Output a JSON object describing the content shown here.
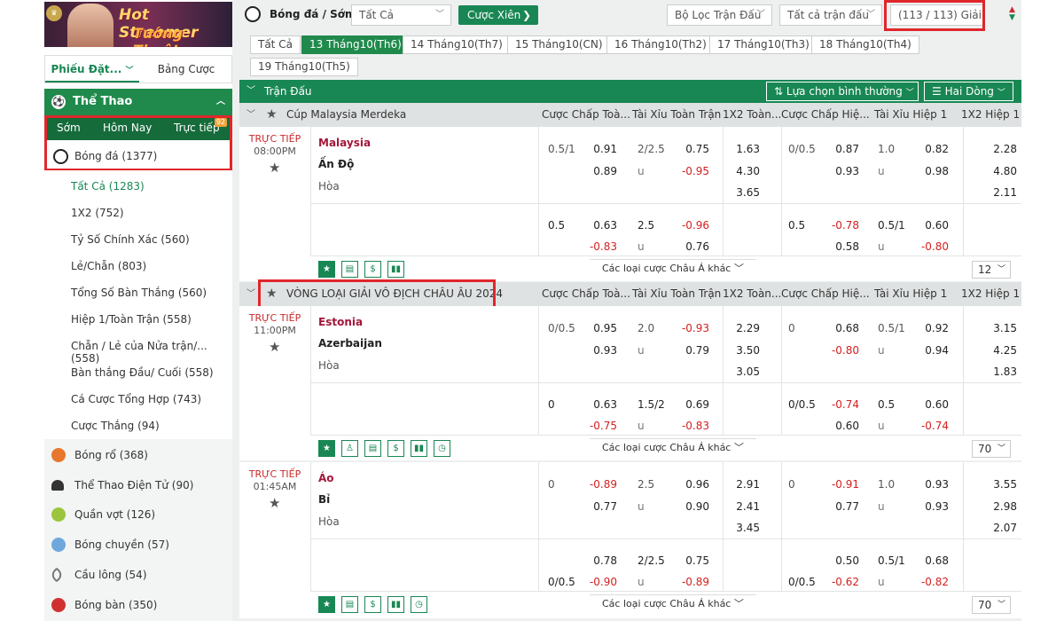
{
  "banner": {
    "line1": "Hot Streamer",
    "line2": "Tướng Thuật"
  },
  "sidebar": {
    "tabs": [
      {
        "label": "Phiếu Đặt..."
      },
      {
        "label": "Bảng Cược"
      }
    ],
    "sport_header": "Thể Thao",
    "subtabs": [
      {
        "label": "Sớm"
      },
      {
        "label": "Hôm Nay"
      },
      {
        "label": "Trực tiếp"
      }
    ],
    "live_badge": "92",
    "current_sport": "Bóng đá (1377)",
    "submenu": [
      {
        "label": "Tất Cả",
        "count": "(1283)"
      },
      {
        "label": "1X2",
        "count": "(752)"
      },
      {
        "label": "Tỷ Số Chính Xác",
        "count": "(560)"
      },
      {
        "label": "Lẻ/Chẵn",
        "count": "(803)"
      },
      {
        "label": "Tổng Số Bàn Thắng",
        "count": "(560)"
      },
      {
        "label": "Hiệp 1/Toàn Trận",
        "count": "(558)"
      },
      {
        "label": "Chẵn / Lẻ của Nửa trận/...",
        "count": "(558)"
      },
      {
        "label": "Bàn thắng Đầu/ Cuối",
        "count": "(558)"
      },
      {
        "label": "Cá Cược Tổng Hợp",
        "count": "(743)"
      },
      {
        "label": "Cược Thắng",
        "count": "(94)"
      }
    ],
    "sports": [
      {
        "label": "Bóng rổ (368)",
        "icon": "basketball-icon",
        "color": "#e8772e"
      },
      {
        "label": "Thể Thao Điện Tử (90)",
        "icon": "headset-icon",
        "color": "#333333"
      },
      {
        "label": "Quần vợt (126)",
        "icon": "tennis-icon",
        "color": "#9bc53d"
      },
      {
        "label": "Bóng chuyền (57)",
        "icon": "volleyball-icon",
        "color": "#6fa8dc"
      },
      {
        "label": "Cầu lông (54)",
        "icon": "badminton-icon",
        "color": "#777777"
      },
      {
        "label": "Bóng bàn (350)",
        "icon": "table-tennis-icon",
        "color": "#d03030"
      }
    ]
  },
  "topbar": {
    "title": "Bóng đá / Sớm",
    "filter_value": "Tất Cả",
    "parlay_button": "Cược Xiên",
    "match_filter": "Bộ Lọc Trận Đấu",
    "all_matches": "Tất cả trận đấu",
    "leagues": "(113 / 113) Giải"
  },
  "dates": [
    "Tất Cả",
    "13 Tháng10(Th6)",
    "14 Tháng10(Th7)",
    "15 Tháng10(CN)",
    "16 Tháng10(Th2)",
    "17 Tháng10(Th3)",
    "18 Tháng10(Th4)",
    "19 Tháng10(Th5)"
  ],
  "table_header": {
    "label": "Trận Đấu",
    "sort_option": "Lựa chọn bình thường",
    "lines_option": "Hai Dòng"
  },
  "columns": [
    "Cược Chấp Toà...",
    "Tài Xỉu Toàn Trận",
    "1X2 Toàn...",
    "Cược Chấp Hiệ...",
    "Tài Xỉu Hiệp 1",
    "1X2 Hiệp 1"
  ],
  "leagues": [
    {
      "name": "Cúp Malaysia Merdeka",
      "matches": [
        {
          "status": "TRỰC TIẾP",
          "time": "08:00PM",
          "home": "Malaysia",
          "away": "Ấn Độ",
          "draw": "Hòa",
          "rows": [
            [
              "0.5/1",
              "0.91",
              "2/2.5",
              "0.75",
              "1.63",
              "0/0.5",
              "0.87",
              "1.0",
              "0.82",
              "2.28"
            ],
            [
              "",
              "0.89",
              "u",
              "-0.95",
              "4.30",
              "",
              "0.93",
              "u",
              "0.98",
              "4.80"
            ],
            [
              "",
              "",
              "",
              "",
              "3.65",
              "",
              "",
              "",
              "",
              "2.11"
            ]
          ],
          "alt": [
            [
              "0.5",
              "0.63",
              "2.5",
              "-0.96",
              "0.5",
              "-0.78",
              "0.5/1",
              "0.60"
            ],
            [
              "",
              "-0.83",
              "u",
              "0.76",
              "",
              "0.58",
              "u",
              "-0.80"
            ]
          ],
          "more_label": "Các loại cược Châu Á khác",
          "count": "12"
        }
      ]
    },
    {
      "name": "VÒNG LOẠI GIẢI VÔ ĐỊCH CHÂU ÂU 2024",
      "matches": [
        {
          "status": "TRỰC TIẾP",
          "time": "11:00PM",
          "home": "Estonia",
          "away": "Azerbaijan",
          "draw": "Hòa",
          "rows": [
            [
              "0/0.5",
              "0.95",
              "2.0",
              "-0.93",
              "2.29",
              "0",
              "0.68",
              "0.5/1",
              "0.92",
              "3.15"
            ],
            [
              "",
              "0.93",
              "u",
              "0.79",
              "3.50",
              "",
              "-0.80",
              "u",
              "0.94",
              "4.25"
            ],
            [
              "",
              "",
              "",
              "",
              "3.05",
              "",
              "",
              "",
              "",
              "1.83"
            ]
          ],
          "alt": [
            [
              "0",
              "0.63",
              "1.5/2",
              "0.69",
              "0/0.5",
              "-0.74",
              "0.5",
              "0.60"
            ],
            [
              "",
              "-0.75",
              "u",
              "-0.83",
              "",
              "0.60",
              "u",
              "-0.74"
            ]
          ],
          "more_label": "Các loại cược Châu Á khác",
          "count": "70"
        },
        {
          "status": "TRỰC TIẾP",
          "time": "01:45AM",
          "home": "Áo",
          "away": "Bỉ",
          "draw": "Hòa",
          "rows": [
            [
              "0",
              "-0.89",
              "2.5",
              "0.96",
              "2.91",
              "0",
              "-0.91",
              "1.0",
              "0.93",
              "3.55"
            ],
            [
              "",
              "0.77",
              "u",
              "0.90",
              "2.41",
              "",
              "0.77",
              "u",
              "0.93",
              "2.98"
            ],
            [
              "",
              "",
              "",
              "",
              "3.45",
              "",
              "",
              "",
              "",
              "2.07"
            ]
          ],
          "alt": [
            [
              "",
              "0.78",
              "2/2.5",
              "0.75",
              "",
              "0.50",
              "0.5/1",
              "0.68"
            ],
            [
              "0/0.5",
              "-0.90",
              "u",
              "-0.89",
              "0/0.5",
              "-0.62",
              "u",
              "-0.82"
            ]
          ],
          "more_label": "Các loại cược Châu Á khác",
          "count": "70"
        }
      ]
    }
  ]
}
